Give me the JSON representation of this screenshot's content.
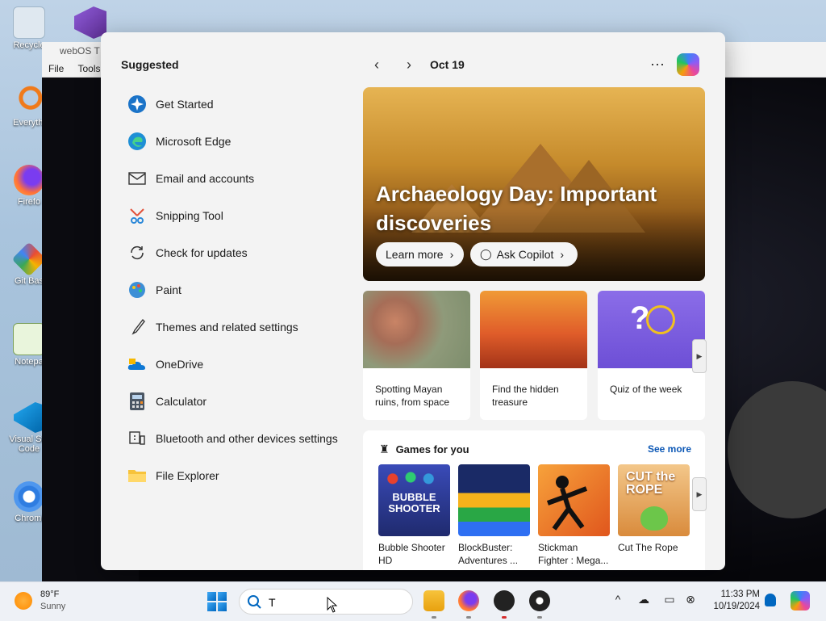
{
  "desktop": {
    "icons": [
      "Recycle",
      "Everythi",
      "Firefo",
      "Git Bas",
      "Notepa",
      "Visual Stu Code",
      "Chromi"
    ]
  },
  "background_window": {
    "title": "webOS T",
    "menu": [
      "File",
      "Tools"
    ]
  },
  "start_panel": {
    "suggested_title": "Suggested",
    "suggested": [
      {
        "label": "Get Started",
        "icon": "get-started-icon"
      },
      {
        "label": "Microsoft Edge",
        "icon": "edge-icon"
      },
      {
        "label": "Email and accounts",
        "icon": "mail-icon"
      },
      {
        "label": "Snipping Tool",
        "icon": "snipping-tool-icon"
      },
      {
        "label": "Check for updates",
        "icon": "refresh-icon"
      },
      {
        "label": "Paint",
        "icon": "paint-icon"
      },
      {
        "label": "Themes and related settings",
        "icon": "brush-icon"
      },
      {
        "label": "OneDrive",
        "icon": "onedrive-icon"
      },
      {
        "label": "Calculator",
        "icon": "calculator-icon"
      },
      {
        "label": "Bluetooth and other devices settings",
        "icon": "devices-icon"
      },
      {
        "label": "File Explorer",
        "icon": "folder-icon"
      }
    ],
    "date": "Oct 19",
    "hero": {
      "title": "Archaeology Day: Important discoveries",
      "learn_more": "Learn more",
      "ask_copilot": "Ask Copilot"
    },
    "cards": [
      {
        "text": "Spotting Mayan ruins, from space"
      },
      {
        "text": "Find the hidden treasure"
      },
      {
        "text": "Quiz of the week"
      }
    ],
    "games": {
      "title": "Games for you",
      "see_more": "See more",
      "items": [
        {
          "name": "Bubble Shooter HD",
          "art_text": "BUBBLE SHOOTER"
        },
        {
          "name": "BlockBuster: Adventures ..."
        },
        {
          "name": "Stickman Fighter : Mega..."
        },
        {
          "name": "Cut The Rope",
          "art_text": "CUT the ROPE"
        }
      ]
    }
  },
  "taskbar": {
    "temperature": "89°F",
    "condition": "Sunny",
    "search_value": "T",
    "time": "11:33 PM",
    "date": "10/19/2024",
    "accent": "#0067c0"
  }
}
